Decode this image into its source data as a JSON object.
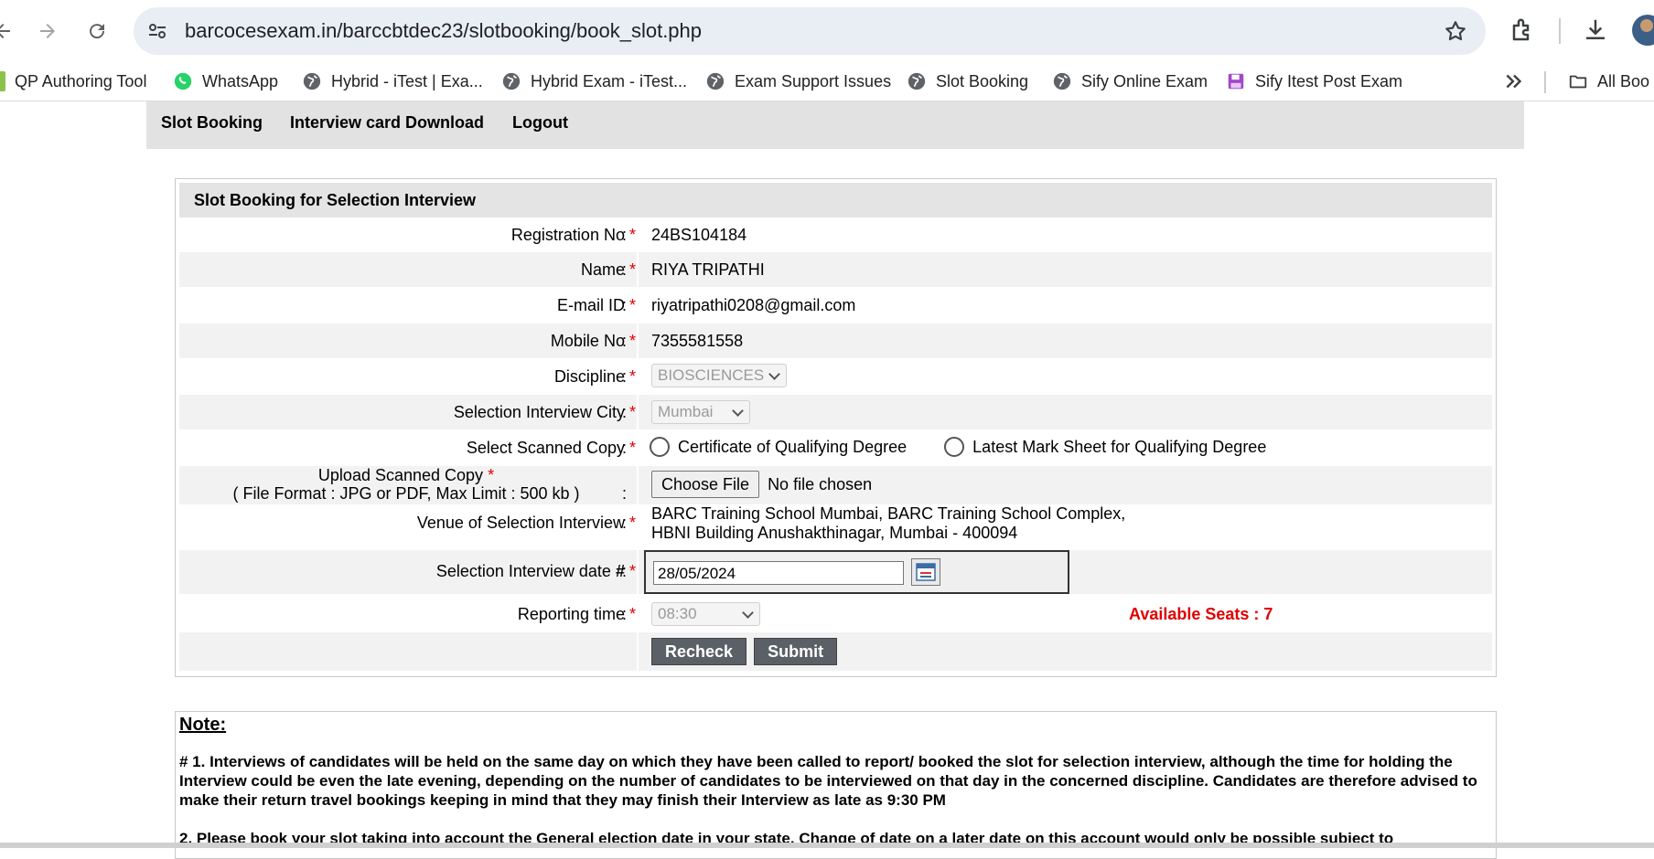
{
  "browser": {
    "url": "barcocesexam.in/barccbtdec23/slotbooking/book_slot.php",
    "bookmarks": [
      {
        "label": "QP Authoring Tool",
        "icon": "qp-icon"
      },
      {
        "label": "WhatsApp",
        "icon": "whatsapp-icon"
      },
      {
        "label": "Hybrid - iTest | Exa...",
        "icon": "globe-icon"
      },
      {
        "label": "Hybrid Exam - iTest...",
        "icon": "globe-icon"
      },
      {
        "label": "Exam Support Issues",
        "icon": "globe-icon"
      },
      {
        "label": "Slot Booking",
        "icon": "globe-icon"
      },
      {
        "label": "Sify Online Exam",
        "icon": "globe-icon"
      },
      {
        "label": "Sify Itest Post Exam",
        "icon": "save-icon"
      }
    ],
    "all_bookmarks_label": "All Boo"
  },
  "menu": {
    "slot_booking": "Slot Booking",
    "interview_card": "Interview card Download",
    "logout": "Logout"
  },
  "form": {
    "title": "Slot Booking for Selection Interview",
    "required_mark": "*",
    "colon": ":",
    "registration": {
      "label": "Registration No",
      "value": "24BS104184"
    },
    "name": {
      "label": "Name",
      "value": "RIYA TRIPATHI"
    },
    "email": {
      "label": "E-mail ID",
      "value": "riyatripathi0208@gmail.com"
    },
    "mobile": {
      "label": "Mobile No",
      "value": "7355581558"
    },
    "discipline": {
      "label": "Discipline",
      "value": "BIOSCIENCES"
    },
    "city": {
      "label": "Selection Interview City",
      "value": "Mumbai"
    },
    "scanned_copy": {
      "label": "Select Scanned Copy",
      "option1": "Certificate of Qualifying Degree",
      "option2": "Latest Mark Sheet for Qualifying Degree"
    },
    "upload": {
      "label": "Upload Scanned Copy",
      "sublabel": "( File Format : JPG or PDF, Max Limit : 500 kb )",
      "button": "Choose File",
      "status": "No file chosen"
    },
    "venue": {
      "label": "Venue of Selection Interview",
      "line1": "BARC Training School Mumbai, BARC Training School Complex,",
      "line2": "HBNI Building Anushakthinagar, Mumbai - 400094"
    },
    "interview_date": {
      "label": "Selection Interview date",
      "hash": "#",
      "value": "28/05/2024"
    },
    "reporting_time": {
      "label": "Reporting time",
      "value": "08:30"
    },
    "available_seats": "Available Seats : 7",
    "recheck_button": "Recheck",
    "submit_button": "Submit"
  },
  "note": {
    "title": "Note:",
    "para1": "# 1. Interviews of candidates will be held on the same day on which they have been called to report/ booked the slot for selection interview, although the time for holding the Interview could be even the late evening, depending on the number of candidates to be interviewed on that day in the concerned discipline. Candidates are therefore advised to make their return travel bookings keeping in mind that they may finish their Interview as late as 9:30 PM",
    "para2": "2. Please book your slot taking into account the General election date in your state. Change of date on a later date on this account would only be possible subject to"
  },
  "colors": {
    "required": "#e00000",
    "available_seats": "#e00000",
    "button_dark": "#5b6066",
    "header_bg": "#e4e4e4"
  }
}
